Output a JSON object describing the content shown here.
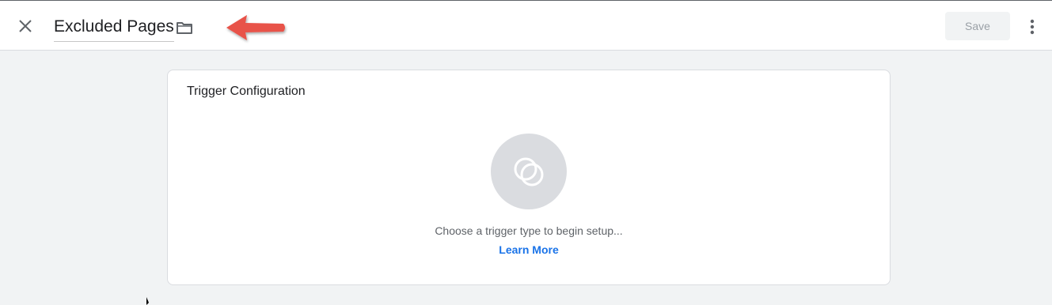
{
  "header": {
    "title": "Excluded Pages",
    "save_label": "Save"
  },
  "icons": {
    "close": "close-icon",
    "folder": "folder-icon",
    "more": "more-vert-icon",
    "annotation": "red-arrow-annotation",
    "trigger": "trigger-type-icon"
  },
  "card": {
    "title": "Trigger Configuration",
    "prompt": "Choose a trigger type to begin setup...",
    "link": "Learn More"
  },
  "colors": {
    "accent_link": "#1a73e8",
    "annotation_arrow": "#e8524a",
    "background": "#f1f3f4"
  }
}
